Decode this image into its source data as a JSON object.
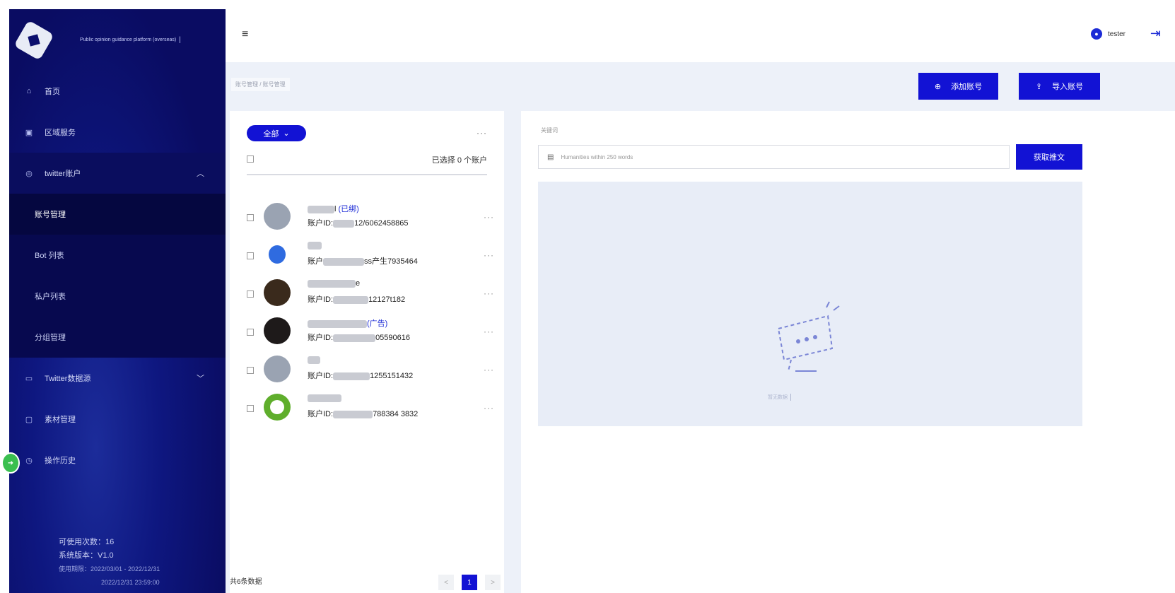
{
  "sidebar": {
    "brand_title": "Public opinion guidance platform (overseas)",
    "brand_caret": "|",
    "menu": [
      {
        "label": "首页",
        "icon": "home-icon"
      },
      {
        "label": "区域服务",
        "icon": "region-icon"
      },
      {
        "label": "twitter账户",
        "icon": "twitter-icon",
        "expanded": true
      }
    ],
    "submenu": [
      {
        "label": "账号管理",
        "active": true
      },
      {
        "label": "Bot 列表"
      },
      {
        "label": "私户列表"
      },
      {
        "label": "分组管理"
      }
    ],
    "menu_after": [
      {
        "label": "Twitter数据源",
        "icon": "monitor-icon",
        "has_arrow": true
      },
      {
        "label": "素材管理",
        "icon": "folder-icon"
      },
      {
        "label": "操作历史",
        "icon": "clock-icon"
      }
    ],
    "footer": {
      "line1": "可使用次数：16",
      "line2": "系统版本：V1.0",
      "line3": "使用期限：2022/03/01 - 2022/12/31",
      "line4": "2022/12/31 23:59:00"
    }
  },
  "header": {
    "menu_icon": "≡",
    "username": "tester",
    "logout_icon": "⇥"
  },
  "content": {
    "breadcrumb": "账号管理 / 账号管理",
    "add_button": "添加账号",
    "import_button": "导入账号"
  },
  "left_panel": {
    "filter_label": "全部",
    "selected_text": "已选择 0 个账户",
    "total_text": "共6条数据",
    "pager": {
      "prev": "<",
      "current": "1",
      "next": ">"
    },
    "accounts": [
      {
        "name_tail": "l",
        "tag": "(已绑)",
        "uid_label": "账户ID:",
        "uid_tail": "12/6062458865"
      },
      {
        "name_tail": "",
        "tag": "",
        "uid_label": "账户",
        "uid_tail": "ss产生7935464"
      },
      {
        "name_tail": "e",
        "tag": "",
        "uid_label": "账户ID:",
        "uid_tail": "12127t182"
      },
      {
        "name_tail": "",
        "tag": "(广告)",
        "uid_label": "账户ID:",
        "uid_tail": "05590616"
      },
      {
        "name_tail": "",
        "tag": "",
        "uid_label": "账户ID:",
        "uid_tail": "1255151432"
      },
      {
        "name_tail": "",
        "tag": "",
        "uid_label": "账户ID:",
        "uid_tail": "788384 3832"
      }
    ]
  },
  "right_panel": {
    "label": "关键词",
    "search_placeholder": "Humanities within 250 words",
    "get_button": "获取推文",
    "empty_text": "暂无数据"
  }
}
